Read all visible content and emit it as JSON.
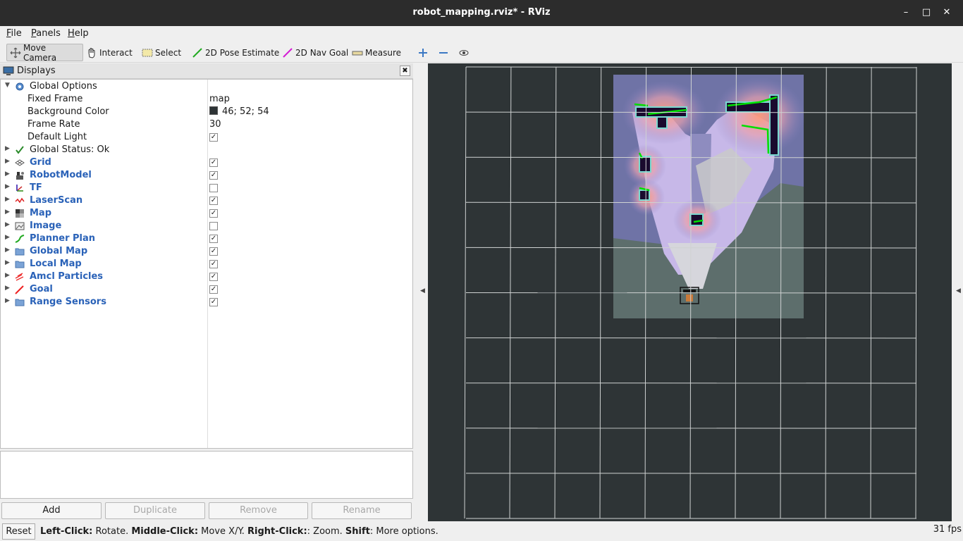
{
  "window": {
    "title": "robot_mapping.rviz* - RViz"
  },
  "menu": [
    {
      "pre": "",
      "key": "F",
      "post": "ile"
    },
    {
      "pre": "",
      "key": "P",
      "post": "anels"
    },
    {
      "pre": "",
      "key": "H",
      "post": "elp"
    }
  ],
  "toolbar": {
    "move_camera": "Move Camera",
    "interact": "Interact",
    "select": "Select",
    "pose_estimate": "2D Pose Estimate",
    "nav_goal": "2D Nav Goal",
    "measure": "Measure"
  },
  "displays": {
    "title": "Displays",
    "global_options": {
      "label": "Global Options",
      "fixed_frame_label": "Fixed Frame",
      "fixed_frame": "map",
      "bg_color_label": "Background Color",
      "bg_color": "46; 52; 54",
      "frame_rate_label": "Frame Rate",
      "frame_rate": "30",
      "default_light_label": "Default Light",
      "default_light": true
    },
    "global_status": "Global Status: Ok",
    "items": [
      {
        "label": "Grid",
        "checked": true,
        "icon": "grid-icon"
      },
      {
        "label": "RobotModel",
        "checked": true,
        "icon": "robot-icon"
      },
      {
        "label": "TF",
        "checked": false,
        "icon": "axes-icon"
      },
      {
        "label": "LaserScan",
        "checked": true,
        "icon": "laser-icon"
      },
      {
        "label": "Map",
        "checked": true,
        "icon": "map-icon"
      },
      {
        "label": "Image",
        "checked": false,
        "icon": "image-icon"
      },
      {
        "label": "Planner Plan",
        "checked": true,
        "icon": "path-icon"
      },
      {
        "label": "Global Map",
        "checked": true,
        "icon": "folder-icon"
      },
      {
        "label": "Local Map",
        "checked": true,
        "icon": "folder-icon"
      },
      {
        "label": "Amcl Particles",
        "checked": true,
        "icon": "particles-icon"
      },
      {
        "label": "Goal",
        "checked": true,
        "icon": "goal-icon"
      },
      {
        "label": "Range Sensors",
        "checked": true,
        "icon": "folder-icon"
      }
    ]
  },
  "buttons": {
    "add": "Add",
    "duplicate": "Duplicate",
    "remove": "Remove",
    "rename": "Rename"
  },
  "status": {
    "reset": "Reset",
    "help_parts": [
      {
        "b": "Left-Click:",
        "t": " Rotate. "
      },
      {
        "b": "Middle-Click:",
        "t": " Move X/Y. "
      },
      {
        "b": "Right-Click:",
        "t": ": Zoom. "
      },
      {
        "b": "Shift",
        "t": ": More options."
      }
    ],
    "fps": "31 fps"
  },
  "colors": {
    "viewport_bg": "#2e3436",
    "grid": "#cfd2d2",
    "path": "#00e000",
    "obstacle": "#1a0a2e"
  }
}
